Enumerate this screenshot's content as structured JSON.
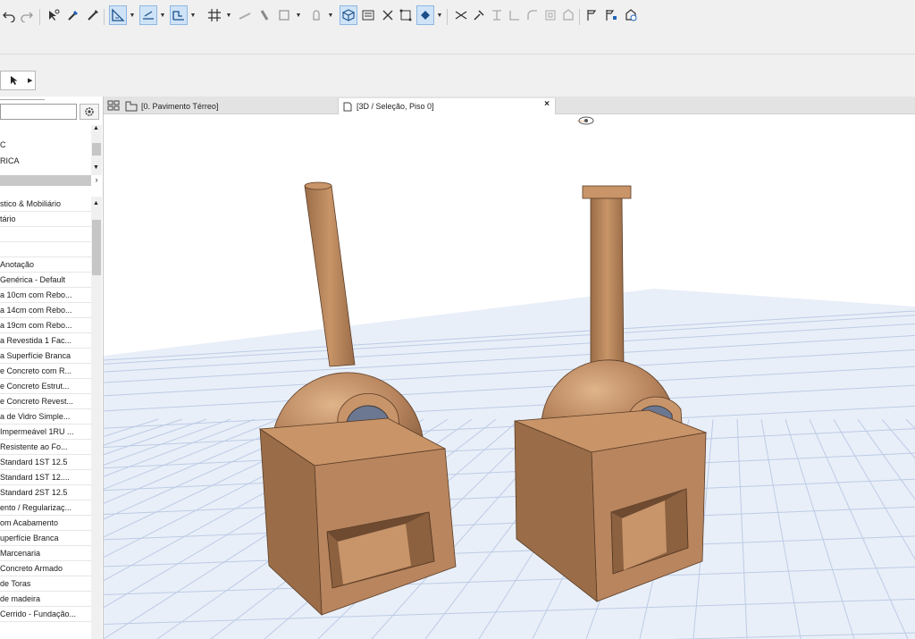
{
  "toolbar": {
    "tools": [
      "arrow-icon",
      "undo-icon",
      "redo-icon",
      "find-select-icon",
      "eyedropper-icon",
      "inject-icon",
      "trace-icon",
      "layer-icon",
      "floor-icon",
      "grid-icon",
      "layout-icon",
      "hatch-icon",
      "section-icon",
      "gravity-icon",
      "3d-window-icon",
      "cutting-plane-icon",
      "move-icon",
      "stretch-icon",
      "rotate-icon",
      "fill-icon",
      "split-icon",
      "adjust-icon",
      "trim-icon",
      "intersect-icon",
      "fillet-icon",
      "offset-icon",
      "mirror-icon",
      "flag-icon",
      "flag-floor-icon",
      "publish-icon"
    ]
  },
  "navigator": {
    "search_value": "",
    "tree_items": [
      "C",
      "RICA"
    ],
    "list_items": [
      "stico & Mobiliário",
      "tário",
      "",
      "",
      "Anotação",
      "Genérica - Default",
      "a 10cm com Rebo...",
      "a 14cm com Rebo...",
      "a 19cm com Rebo...",
      "a Revestida 1 Fac...",
      "a Superfície Branca",
      "e Concreto com R...",
      "e Concreto Estrut...",
      "e Concreto Revest...",
      "a de Vidro Simple...",
      "Impermeável 1RU ...",
      "Resistente ao Fo...",
      "Standard 1ST 12.5",
      "Standard 1ST 12....",
      "Standard 2ST 12.5",
      "ento / Regularizaç...",
      "om Acabamento",
      "uperfície Branca",
      "Marcenaria",
      "Concreto Armado",
      "de Toras",
      "de madeira",
      "Cerrido - Fundação..."
    ]
  },
  "tabs": {
    "plan_label": "[0. Pavimento Térreo]",
    "view3d_label": "[3D / Seleção, Piso 0]",
    "close_symbol": "×"
  },
  "viewport": {
    "indicator": "----"
  },
  "colors": {
    "oven": "#b8855e",
    "oven_dark": "#8c6140",
    "oven_light": "#d8ad82",
    "grid_line": "#b9c9e6",
    "glass": "#6c7891"
  }
}
